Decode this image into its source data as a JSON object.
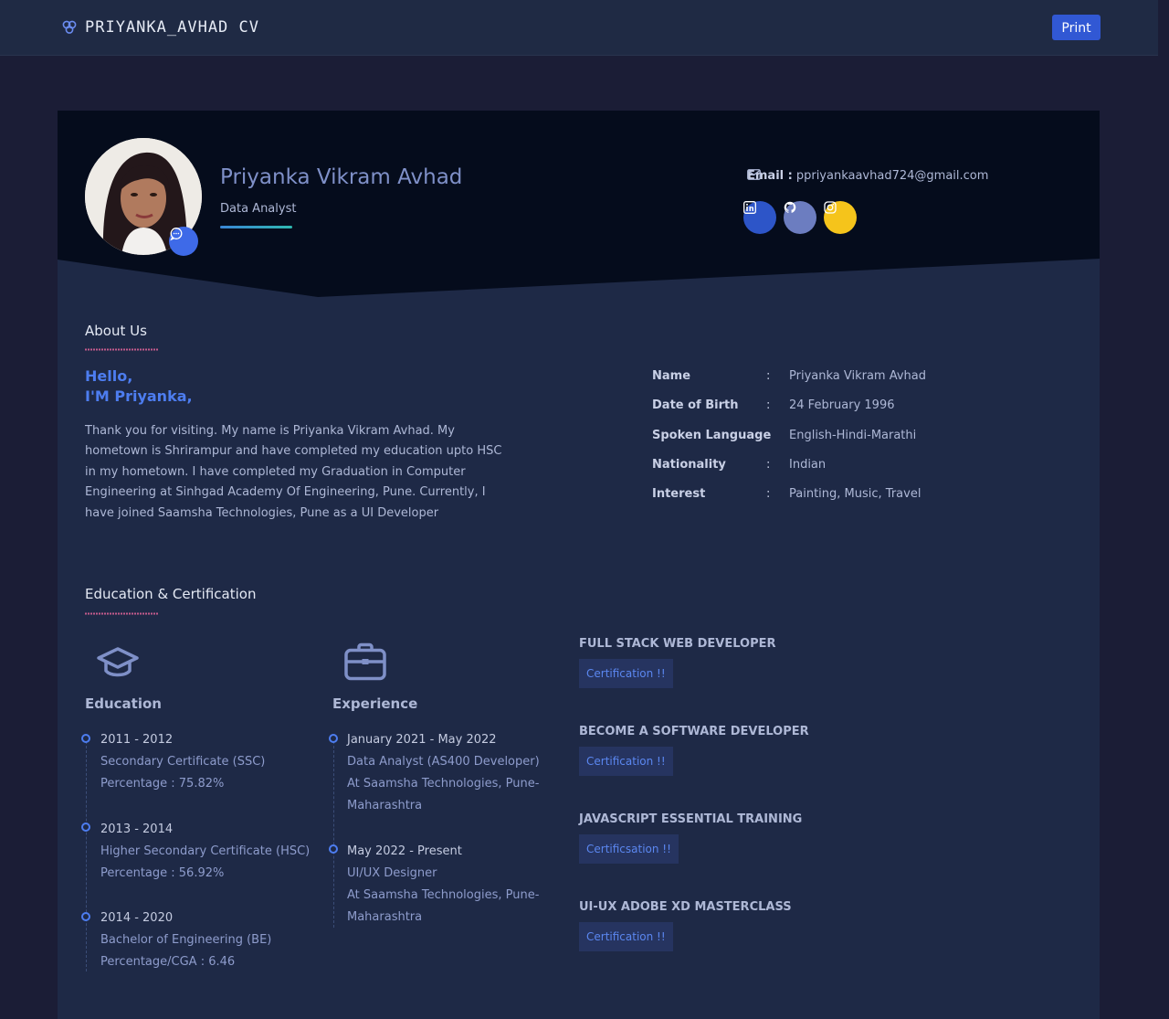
{
  "navbar": {
    "brand": "PRIYANKA_AVHAD CV",
    "print_label": "Print",
    "brand_icon": "cluster-icon"
  },
  "profile": {
    "name": "Priyanka Vikram Avhad",
    "role": "Data Analyst",
    "email_label": "Email :",
    "email": "ppriyankaavhad724@gmail.com",
    "social": [
      {
        "name": "linkedin",
        "color": "#2d55c8"
      },
      {
        "name": "github",
        "color": "#6c7dc0"
      },
      {
        "name": "instagram",
        "color": "#f5c41b"
      }
    ]
  },
  "about": {
    "title": "About Us",
    "hello_line1": "Hello,",
    "hello_line2": "I'M Priyanka,",
    "text": "Thank you for visiting. My name is Priyanka Vikram Avhad. My hometown is Shrirampur and have completed my education upto HSC in my hometown. I have completed my Graduation in Computer Engineering at Sinhgad Academy Of Engineering, Pune. Currently, I have joined Saamsha Technologies, Pune as a UI Developer",
    "info": [
      {
        "label": "Name",
        "colon": ":",
        "value": "Priyanka Vikram Avhad"
      },
      {
        "label": "Date of Birth",
        "colon": ":",
        "value": "24 February 1996"
      },
      {
        "label": "Spoken Language",
        "colon": ":",
        "value": "English-Hindi-Marathi"
      },
      {
        "label": "Nationality",
        "colon": ":",
        "value": "Indian"
      },
      {
        "label": "Interest",
        "colon": ":",
        "value": "Painting, Music, Travel"
      }
    ]
  },
  "education_section": {
    "title": "Education & Certification",
    "education": {
      "heading": "Education",
      "items": [
        {
          "date": "2011 - 2012",
          "line1": "Secondary Certificate (SSC)",
          "line2": "Percentage : 75.82%"
        },
        {
          "date": "2013 - 2014",
          "line1": "Higher Secondary Certificate (HSC)",
          "line2": "Percentage : 56.92%"
        },
        {
          "date": "2014 - 2020",
          "line1": "Bachelor of Engineering (BE)",
          "line2": "Percentage/CGA : 6.46"
        }
      ]
    },
    "experience": {
      "heading": "Experience",
      "items": [
        {
          "date": "January 2021 - May 2022",
          "line1": "Data Analyst (AS400 Developer)",
          "line2": "At Saamsha Technologies, Pune-",
          "line3": "Maharashtra"
        },
        {
          "date": "May 2022 - Present",
          "line1": "UI/UX Designer",
          "line2": "At Saamsha Technologies, Pune-",
          "line3": "Maharashtra"
        }
      ]
    },
    "certifications": [
      {
        "title": "FULL STACK WEB DEVELOPER",
        "button": "Certification !!"
      },
      {
        "title": "BECOME A SOFTWARE DEVELOPER",
        "button": "Certification !!"
      },
      {
        "title": "JAVASCRIPT ESSENTIAL TRAINING",
        "button": "Certificsation !!"
      },
      {
        "title": "UI-UX ADOBE XD MASTERCLASS",
        "button": "Certification !!"
      }
    ]
  },
  "colors": {
    "accent": "#4d7df0",
    "print_button": "#3158d4",
    "hero_background": "#050c1c",
    "card_background": "#1e2946"
  }
}
